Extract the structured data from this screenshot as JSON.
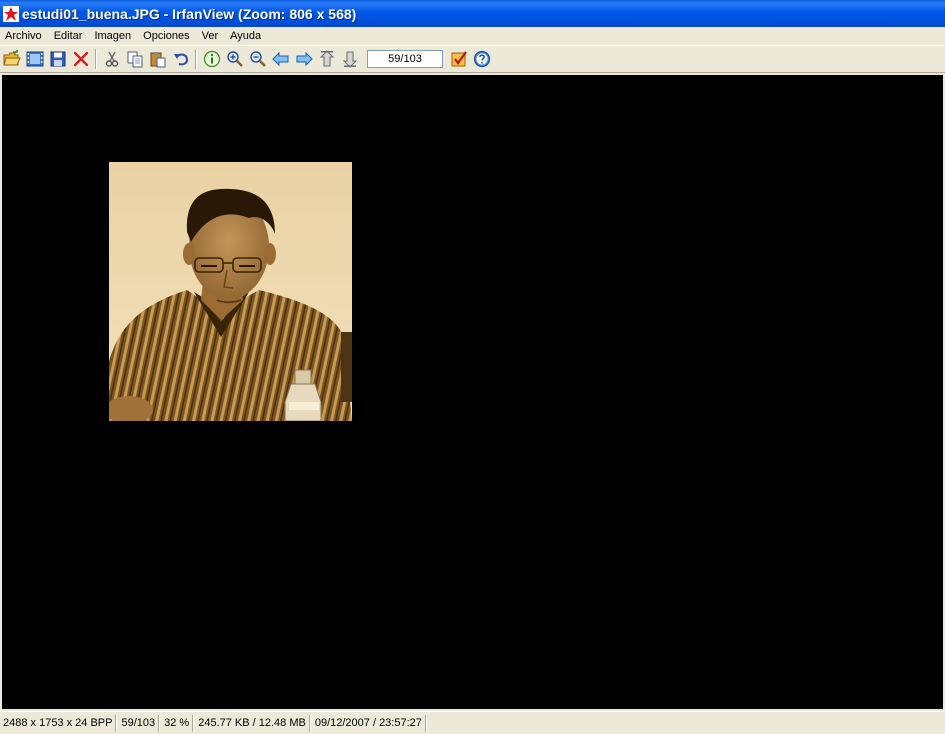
{
  "window": {
    "title": "estudi01_buena.JPG - IrfanView (Zoom: 806 x 568)"
  },
  "menu": {
    "items": [
      "Archivo",
      "Editar",
      "Imagen",
      "Opciones",
      "Ver",
      "Ayuda"
    ]
  },
  "toolbar": {
    "icons": [
      "open-folder-icon",
      "slideshow-icon",
      "save-icon",
      "delete-icon",
      "cut-icon",
      "copy-icon",
      "paste-icon",
      "undo-icon",
      "info-icon",
      "zoom-in-icon",
      "zoom-out-icon",
      "previous-arrow-icon",
      "next-arrow-icon",
      "first-page-icon",
      "last-page-icon",
      "properties-checkbox-icon",
      "help-icon"
    ],
    "page_indicator": "59/103"
  },
  "status": {
    "dimensions": "2488 x 1753 x 24 BPP",
    "page": "59/103",
    "zoom": "32 %",
    "filesize": "245.77 KB / 12.48 MB",
    "datetime": "09/12/2007 / 23:57:27"
  },
  "colors": {
    "titlebar": "#0054e3",
    "viewport_background": "#000000",
    "chrome": "#ece9d8",
    "photo_sepia": "#a0773a"
  }
}
